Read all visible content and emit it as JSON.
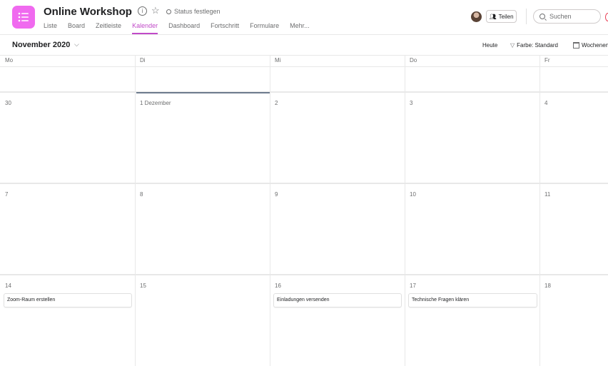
{
  "project": {
    "title": "Online Workshop",
    "status": "Status festlegen"
  },
  "tabs": [
    "Liste",
    "Board",
    "Zeitleiste",
    "Kalender",
    "Dashboard",
    "Fortschritt",
    "Formulare",
    "Mehr..."
  ],
  "header": {
    "share_label": "Teilen",
    "search_placeholder": "Suchen"
  },
  "toolbar": {
    "month_label": "November 2020",
    "today_label": "Heute",
    "color_label": "Farbe: Standard",
    "weeks_label": "Wochenen"
  },
  "weekdays": [
    "Mo",
    "Di",
    "Mi",
    "Do",
    "Fr"
  ],
  "weeks": [
    [
      "30",
      "1 Dezember",
      "2",
      "3",
      "4"
    ],
    [
      "7",
      "8",
      "9",
      "10",
      "11"
    ],
    [
      "14",
      "15",
      "16",
      "17",
      "18"
    ]
  ],
  "tasks": [
    {
      "day": "14",
      "title": "Zoom-Raum erstellen"
    },
    {
      "day": "16",
      "title": "Einladungen versenden"
    },
    {
      "day": "17",
      "title": "Technische Fragen klären"
    }
  ],
  "colors": {
    "accent": "#c14ac8",
    "app_icon": "#f06aef",
    "today_marker": "#6d7b8d"
  }
}
